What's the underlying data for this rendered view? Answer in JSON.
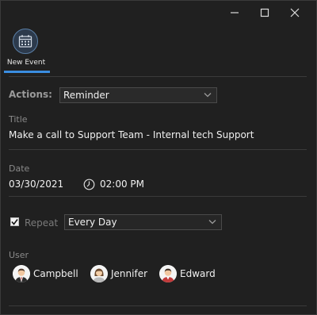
{
  "ribbon": {
    "new_event_label": "New Event"
  },
  "form": {
    "actions_label": "Actions:",
    "actions_value": "Reminder",
    "title_label": "Title",
    "title_value": "Make a call to Support Team - Internal tech Support",
    "date_label": "Date",
    "date_value": "03/30/2021",
    "time_value": "02:00 PM",
    "repeat_label": "Repeat",
    "repeat_checked": true,
    "repeat_value": "Every Day",
    "user_label": "User",
    "users": [
      {
        "name": "Campbell",
        "shirt_color": "#c23a3a"
      },
      {
        "name": "Jennifer",
        "shirt_color": "#b9b9b9"
      },
      {
        "name": "Edward",
        "shirt_color": "#c23a3a"
      }
    ]
  },
  "icons": {
    "minimize": "minimize-icon",
    "maximize": "maximize-icon",
    "close": "close-icon",
    "calendar": "calendar-icon",
    "clock": "clock-icon",
    "chevron": "chevron-down-icon"
  },
  "colors": {
    "background": "#202020",
    "accent": "#3a8de0"
  }
}
